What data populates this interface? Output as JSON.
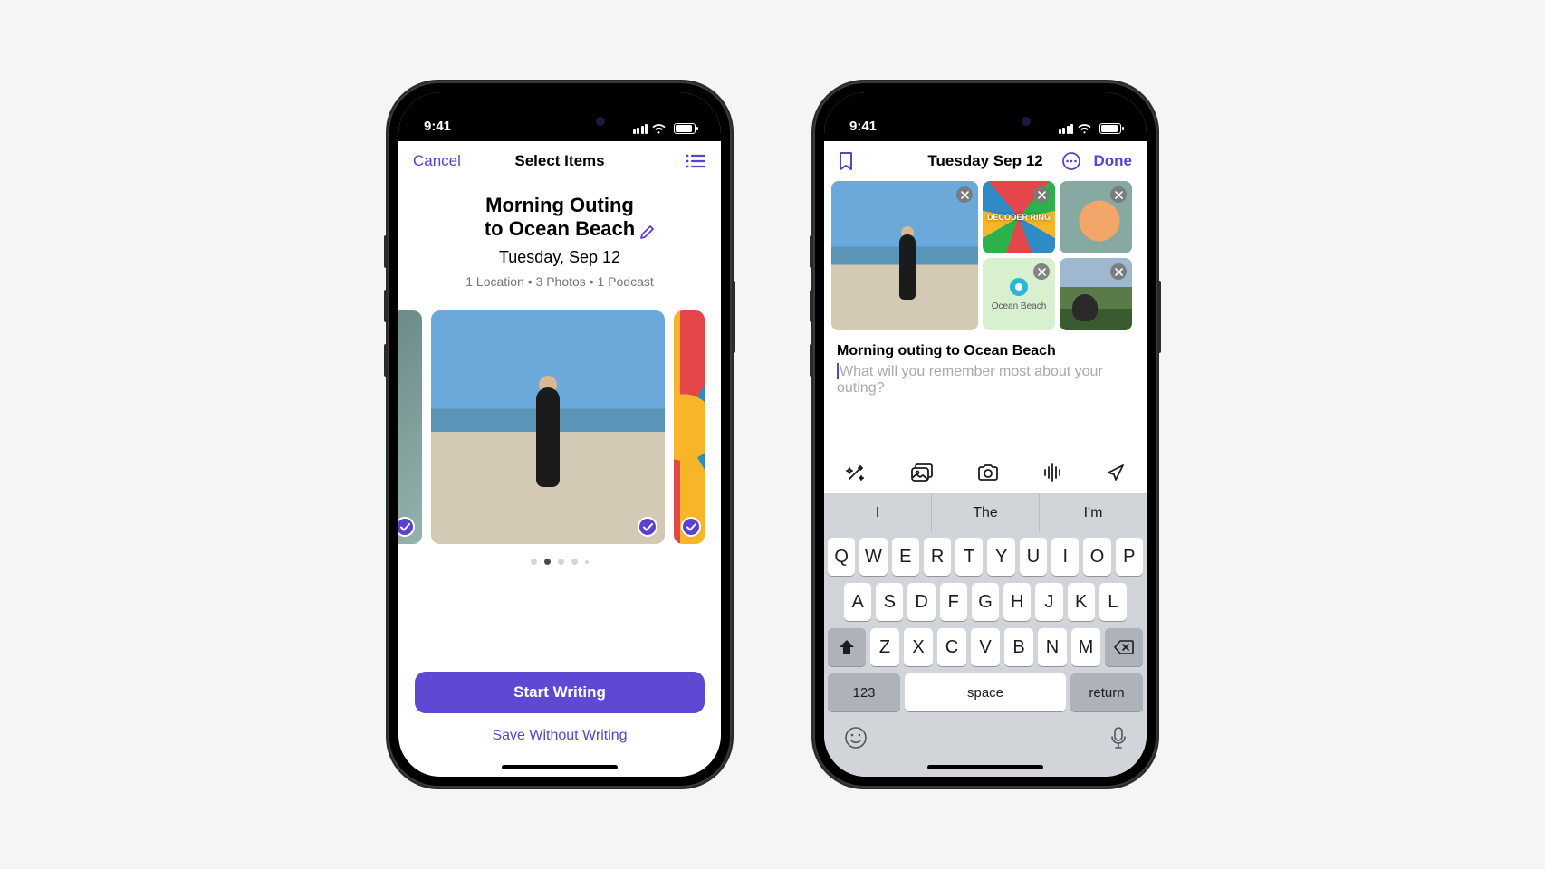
{
  "status_bar": {
    "time": "9:41"
  },
  "phone1": {
    "nav": {
      "cancel": "Cancel",
      "title": "Select Items",
      "list_icon": "list-icon"
    },
    "header": {
      "title_line1": "Morning Outing",
      "title_line2": "to Ocean Beach",
      "date": "Tuesday, Sep 12",
      "meta": "1 Location • 3 Photos • 1 Podcast"
    },
    "page_dots": {
      "count": 5,
      "active_index": 1
    },
    "actions": {
      "primary": "Start Writing",
      "secondary": "Save Without Writing"
    }
  },
  "phone2": {
    "nav": {
      "bookmark_icon": "bookmark-icon",
      "title": "Tuesday Sep 12",
      "more_icon": "more-icon",
      "done": "Done"
    },
    "attachments": {
      "podcast_label": "DECODER RING",
      "map_label": "Ocean Beach"
    },
    "entry": {
      "title": "Morning outing to Ocean Beach",
      "prompt_placeholder": "What will you remember most about your outing?"
    },
    "toolbar_icons": [
      "magic-icon",
      "gallery-icon",
      "camera-icon",
      "audio-icon",
      "location-icon"
    ],
    "keyboard": {
      "suggestions": [
        "I",
        "The",
        "I'm"
      ],
      "row1": [
        "Q",
        "W",
        "E",
        "R",
        "T",
        "Y",
        "U",
        "I",
        "O",
        "P"
      ],
      "row2": [
        "A",
        "S",
        "D",
        "F",
        "G",
        "H",
        "J",
        "K",
        "L"
      ],
      "row3": [
        "Z",
        "X",
        "C",
        "V",
        "B",
        "N",
        "M"
      ],
      "num_key": "123",
      "space_key": "space",
      "return_key": "return"
    }
  }
}
